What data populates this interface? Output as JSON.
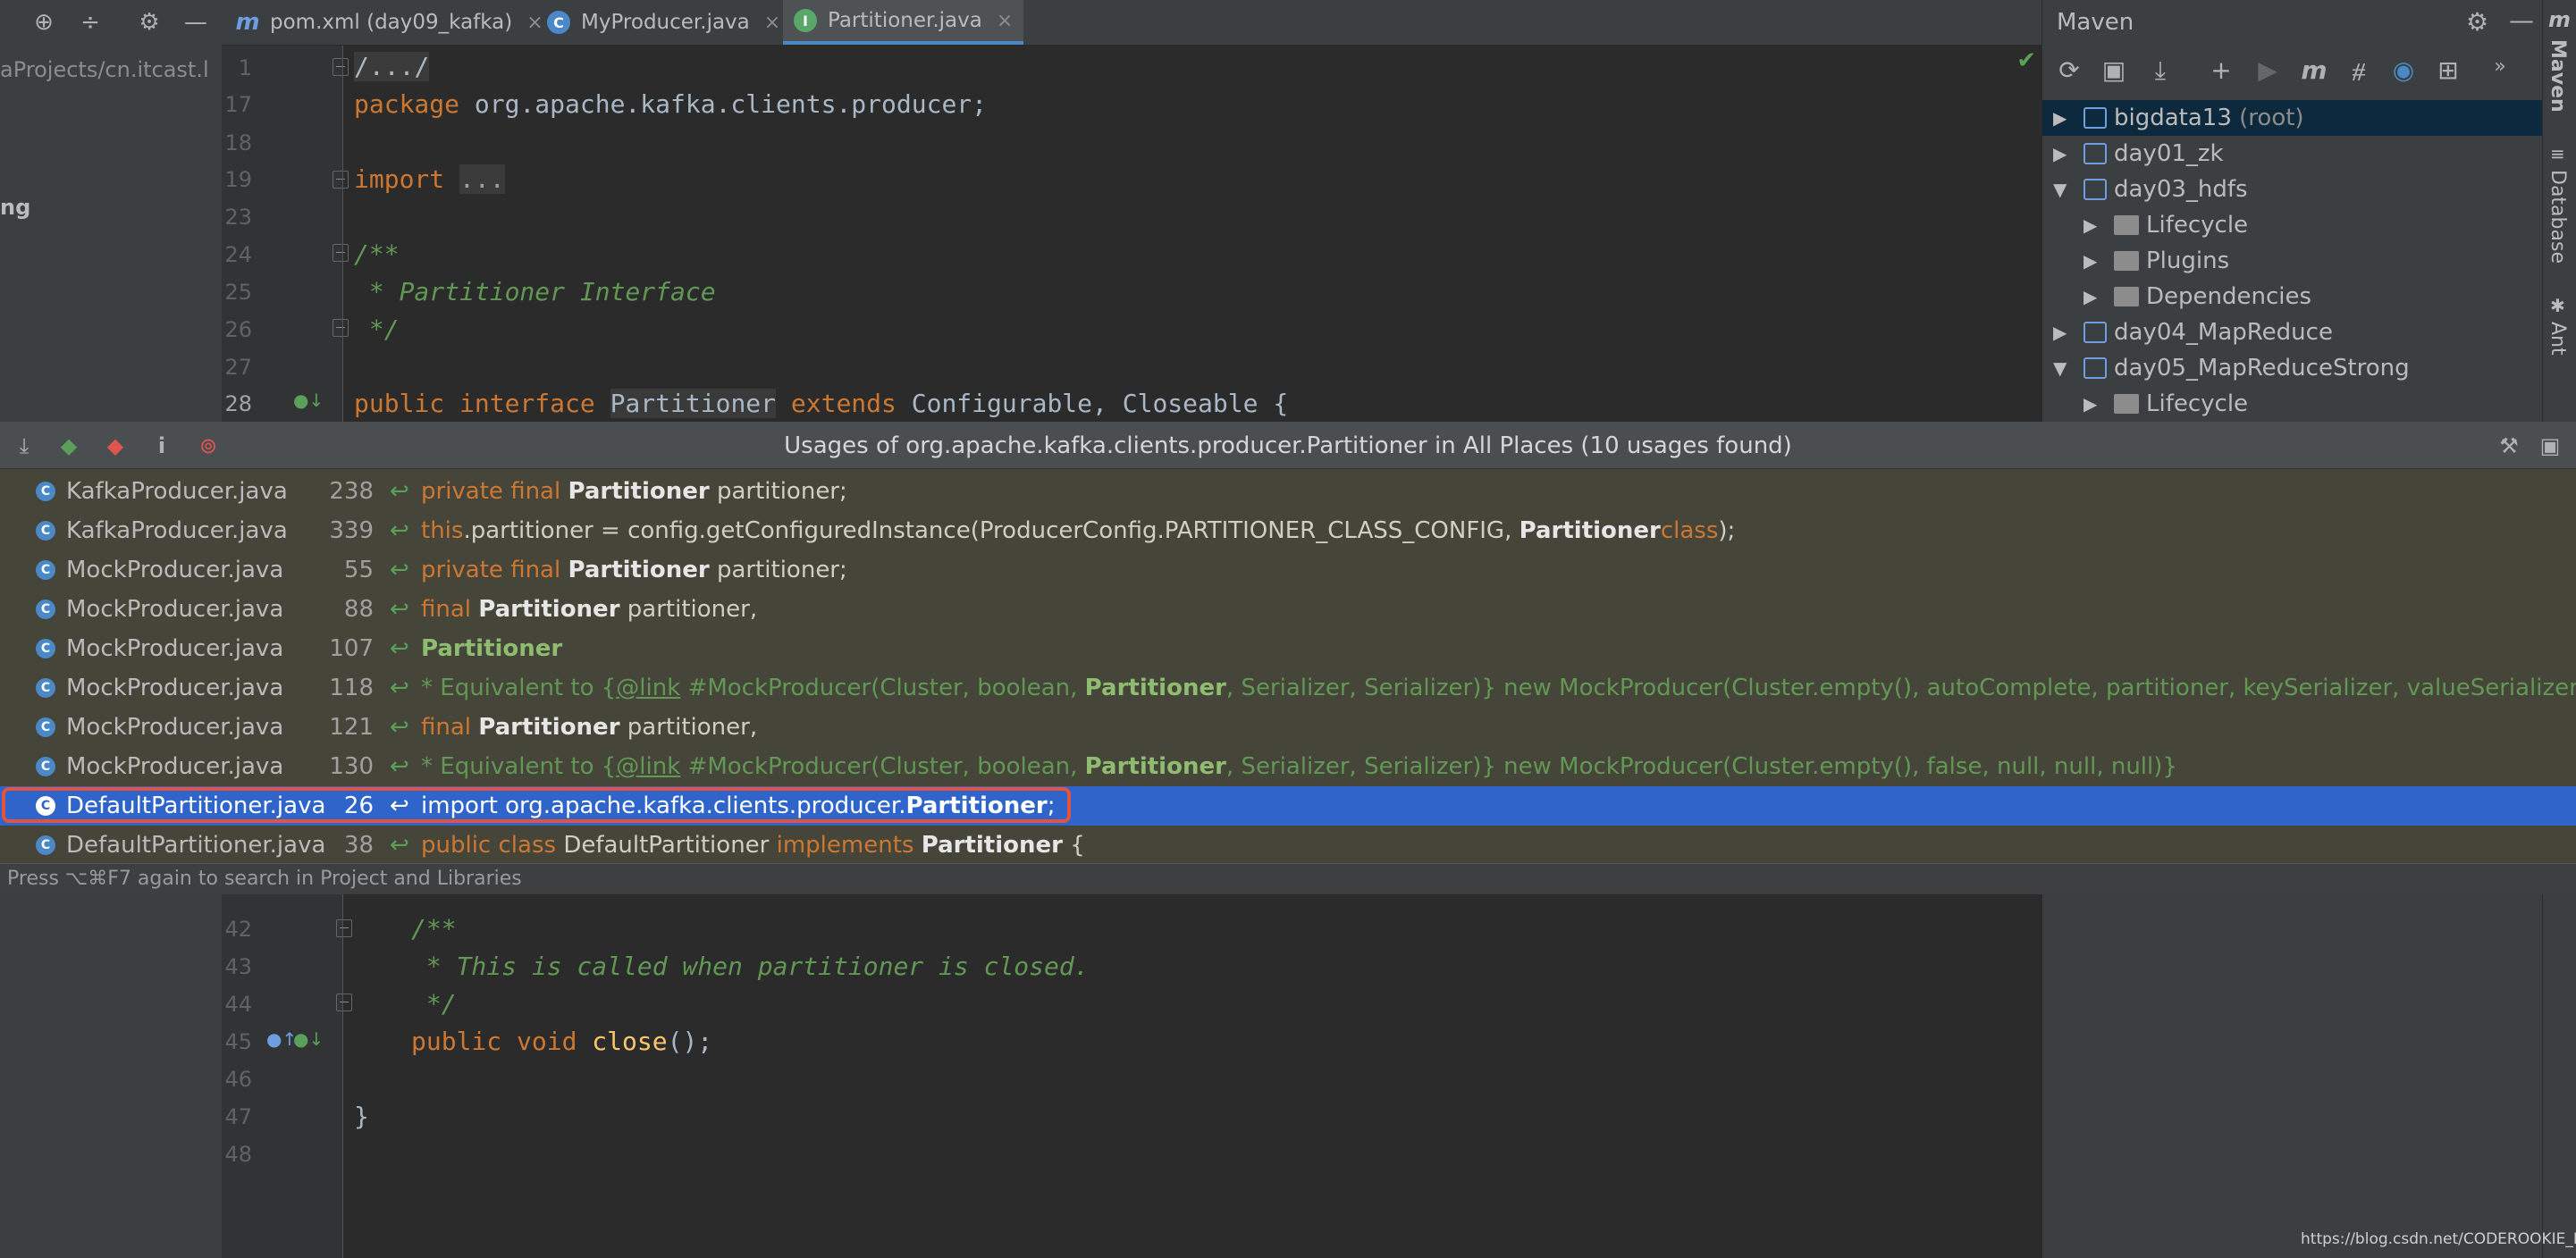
{
  "tabs": [
    {
      "label": "pom.xml (day09_kafka)",
      "icon": "maven-m-icon"
    },
    {
      "label": "MyProducer.java",
      "icon": "class-icon"
    },
    {
      "label": "Partitioner.java",
      "icon": "interface-icon"
    }
  ],
  "project": {
    "path": "aProjects/cn.itcast.l",
    "item": "ng"
  },
  "editor": {
    "lines": [
      {
        "n": "1",
        "text": "/.../"
      },
      {
        "n": "17",
        "text": "package org.apache.kafka.clients.producer;"
      },
      {
        "n": "18",
        "text": ""
      },
      {
        "n": "19",
        "text": "import ..."
      },
      {
        "n": "23",
        "text": ""
      },
      {
        "n": "24",
        "text": "/**"
      },
      {
        "n": "25",
        "text": " * Partitioner Interface"
      },
      {
        "n": "26",
        "text": " */"
      },
      {
        "n": "27",
        "text": ""
      },
      {
        "n": "28",
        "text": "public interface Partitioner extends Configurable, Closeable {"
      },
      {
        "n": "42",
        "text": "/**"
      },
      {
        "n": "43",
        "text": " * This is called when partitioner is closed."
      },
      {
        "n": "44",
        "text": " */"
      },
      {
        "n": "45",
        "text": "public void close();"
      },
      {
        "n": "46",
        "text": ""
      },
      {
        "n": "47",
        "text": "}"
      },
      {
        "n": "48",
        "text": ""
      }
    ]
  },
  "maven": {
    "title": "Maven",
    "items": [
      {
        "label": "bigdata13",
        "suffix": "(root)",
        "expanded": false
      },
      {
        "label": "day01_zk",
        "expanded": false
      },
      {
        "label": "day03_hdfs",
        "expanded": true
      },
      {
        "label": "Lifecycle",
        "expanded": false
      },
      {
        "label": "Plugins",
        "expanded": false
      },
      {
        "label": "Dependencies",
        "expanded": false
      },
      {
        "label": "day04_MapReduce",
        "expanded": false
      },
      {
        "label": "day05_MapReduceStrong",
        "expanded": true
      },
      {
        "label": "Lifecycle",
        "expanded": false
      }
    ]
  },
  "right_strip": {
    "tabs": [
      "Maven",
      "Database",
      "Ant"
    ]
  },
  "usages": {
    "title": "Usages of org.apache.kafka.clients.producer.Partitioner in All Places (10 usages found)",
    "rows": [
      {
        "file": "KafkaProducer.java",
        "line": "238"
      },
      {
        "file": "KafkaProducer.java",
        "line": "339"
      },
      {
        "file": "MockProducer.java",
        "line": "55"
      },
      {
        "file": "MockProducer.java",
        "line": "88"
      },
      {
        "file": "MockProducer.java",
        "line": "107"
      },
      {
        "file": "MockProducer.java",
        "line": "118"
      },
      {
        "file": "MockProducer.java",
        "line": "121"
      },
      {
        "file": "MockProducer.java",
        "line": "130"
      },
      {
        "file": "DefaultPartitioner.java",
        "line": "26"
      },
      {
        "file": "DefaultPartitioner.java",
        "line": "38"
      }
    ],
    "snippets": {
      "r0": {
        "a": "private final ",
        "b": "Partitioner",
        "c": " partitioner;"
      },
      "r1": {
        "a": "this",
        "b": ".partitioner = config.getConfiguredInstance(ProducerConfig.PARTITIONER_CLASS_CONFIG, ",
        "c": "Partitioner",
        ".": ".",
        "d": "class",
        "e": ");"
      },
      "r2": {
        "a": "private final ",
        "b": "Partitioner",
        "c": " partitioner;"
      },
      "r3": {
        "a": "final ",
        "b": "Partitioner",
        "c": " partitioner,"
      },
      "r4": {
        "b": "Partitioner"
      },
      "r5": {
        "a": "* Equivalent to {",
        "link": "@link",
        "c": " #MockProducer(Cluster, boolean, ",
        "b": "Partitioner",
        "d": ", Serializer, Serializer)} new MockProducer(Cluster.empty(), autoComplete, partitioner, keySerializer, valueSerializer)}"
      },
      "r6": {
        "a": "final ",
        "b": "Partitioner",
        "c": " partitioner,"
      },
      "r7": {
        "a": "* Equivalent to {",
        "link": "@link",
        "c": " #MockProducer(Cluster, boolean, ",
        "b": "Partitioner",
        "d": ", Serializer, Serializer)} new MockProducer(Cluster.empty(), false, null, null, null)}"
      },
      "r8": {
        "a": "import org.apache.kafka.clients.producer.",
        "b": "Partitioner",
        "c": ";"
      },
      "r9": {
        "a": "public class ",
        "m": "DefaultPartitioner ",
        "k": "implements ",
        "b": "Partitioner",
        "c": " {"
      }
    },
    "footer": "Press ⌥⌘F7 again to search in Project and Libraries"
  },
  "watermark": "https://blog.csdn.net/CODEROOKIE_RUN"
}
